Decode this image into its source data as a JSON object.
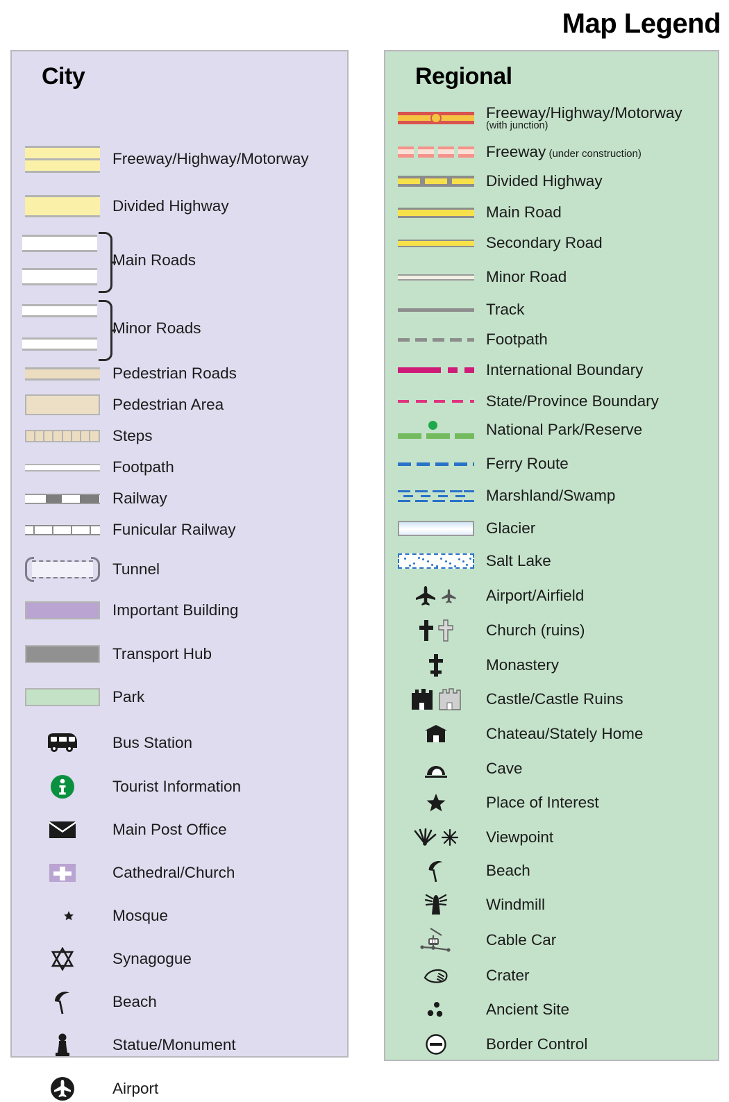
{
  "title": "Map Legend",
  "city": {
    "heading": "City",
    "bg_color": "#dedcee",
    "items": [
      {
        "label": "Freeway/Highway/Motorway",
        "symbol": "city-freeway"
      },
      {
        "label": "Divided Highway",
        "symbol": "city-divided-highway"
      },
      {
        "label": "Main Roads",
        "symbol": "city-main-roads-brace"
      },
      {
        "label": "Minor Roads",
        "symbol": "city-minor-roads-brace"
      },
      {
        "label": "Pedestrian Roads",
        "symbol": "city-pedestrian-road"
      },
      {
        "label": "Pedestrian Area",
        "symbol": "city-pedestrian-area"
      },
      {
        "label": "Steps",
        "symbol": "city-steps"
      },
      {
        "label": "Footpath",
        "symbol": "city-footpath"
      },
      {
        "label": "Railway",
        "symbol": "city-railway"
      },
      {
        "label": "Funicular Railway",
        "symbol": "city-funicular-railway"
      },
      {
        "label": "Tunnel",
        "symbol": "city-tunnel"
      },
      {
        "label": "Important Building",
        "symbol": "city-important-building"
      },
      {
        "label": "Transport Hub",
        "symbol": "city-transport-hub"
      },
      {
        "label": "Park",
        "symbol": "city-park"
      },
      {
        "label": "Bus Station",
        "symbol": "bus-icon"
      },
      {
        "label": "Tourist Information",
        "symbol": "info-icon"
      },
      {
        "label": "Main Post Office",
        "symbol": "envelope-icon"
      },
      {
        "label": "Cathedral/Church",
        "symbol": "cross-square-icon"
      },
      {
        "label": "Mosque",
        "symbol": "crescent-star-icon"
      },
      {
        "label": "Synagogue",
        "symbol": "star-of-david-icon"
      },
      {
        "label": "Beach",
        "symbol": "beach-umbrella-icon"
      },
      {
        "label": "Statue/Monument",
        "symbol": "statue-icon"
      },
      {
        "label": "Airport",
        "symbol": "airplane-circle-icon"
      }
    ]
  },
  "regional": {
    "heading": "Regional",
    "bg_color": "#c4e2ca",
    "items": [
      {
        "label": "Freeway/Highway/Motorway",
        "sublabel": "(with junction)",
        "symbol": "regional-freeway-junction"
      },
      {
        "label": "Freeway",
        "inline_sub": " (under construction)",
        "symbol": "regional-freeway-construction"
      },
      {
        "label": "Divided Highway",
        "symbol": "regional-divided-highway"
      },
      {
        "label": "Main Road",
        "symbol": "regional-main-road"
      },
      {
        "label": "Secondary Road",
        "symbol": "regional-secondary-road"
      },
      {
        "label": "Minor Road",
        "symbol": "regional-minor-road"
      },
      {
        "label": "Track",
        "symbol": "regional-track"
      },
      {
        "label": "Footpath",
        "symbol": "regional-footpath"
      },
      {
        "label": "International Boundary",
        "symbol": "regional-international-boundary"
      },
      {
        "label": "State/Province Boundary",
        "symbol": "regional-state-boundary"
      },
      {
        "label": "National Park/Reserve",
        "symbol": "regional-national-park"
      },
      {
        "label": "Ferry Route",
        "symbol": "regional-ferry-route"
      },
      {
        "label": "Marshland/Swamp",
        "symbol": "regional-marshland"
      },
      {
        "label": "Glacier",
        "symbol": "regional-glacier"
      },
      {
        "label": "Salt Lake",
        "symbol": "regional-salt-lake"
      },
      {
        "label": "Airport/Airfield",
        "symbol": "airplane-pair-icon"
      },
      {
        "label": "Church (ruins)",
        "symbol": "cross-pair-icon"
      },
      {
        "label": "Monastery",
        "symbol": "monastery-cross-icon"
      },
      {
        "label": "Castle/Castle Ruins",
        "symbol": "castle-pair-icon"
      },
      {
        "label": "Chateau/Stately Home",
        "symbol": "chateau-icon"
      },
      {
        "label": "Cave",
        "symbol": "cave-icon"
      },
      {
        "label": "Place of Interest",
        "symbol": "star-icon"
      },
      {
        "label": "Viewpoint",
        "symbol": "viewpoint-pair-icon"
      },
      {
        "label": "Beach",
        "symbol": "beach-umbrella-icon"
      },
      {
        "label": "Windmill",
        "symbol": "windmill-icon"
      },
      {
        "label": "Cable Car",
        "symbol": "cable-car-icon"
      },
      {
        "label": "Crater",
        "symbol": "crater-icon"
      },
      {
        "label": "Ancient Site",
        "symbol": "ancient-site-icon"
      },
      {
        "label": "Border Control",
        "symbol": "border-control-icon"
      }
    ]
  },
  "colors": {
    "city_panel": "#dedcee",
    "regional_panel": "#c4e2ca",
    "highway_yellow": "#faf0a8",
    "road_yellow": "#f7e14a",
    "freeway_red": "#d9534f",
    "pedestrian_beige": "#ecdcc0",
    "important_building": "#b9a4d2",
    "transport_hub": "#919191",
    "park_green": "#c3e2c6",
    "boundary_magenta": "#cf1a78",
    "ferry_blue": "#2a72c8",
    "park_line_green": "#74bb5f",
    "info_green": "#0a9140"
  }
}
